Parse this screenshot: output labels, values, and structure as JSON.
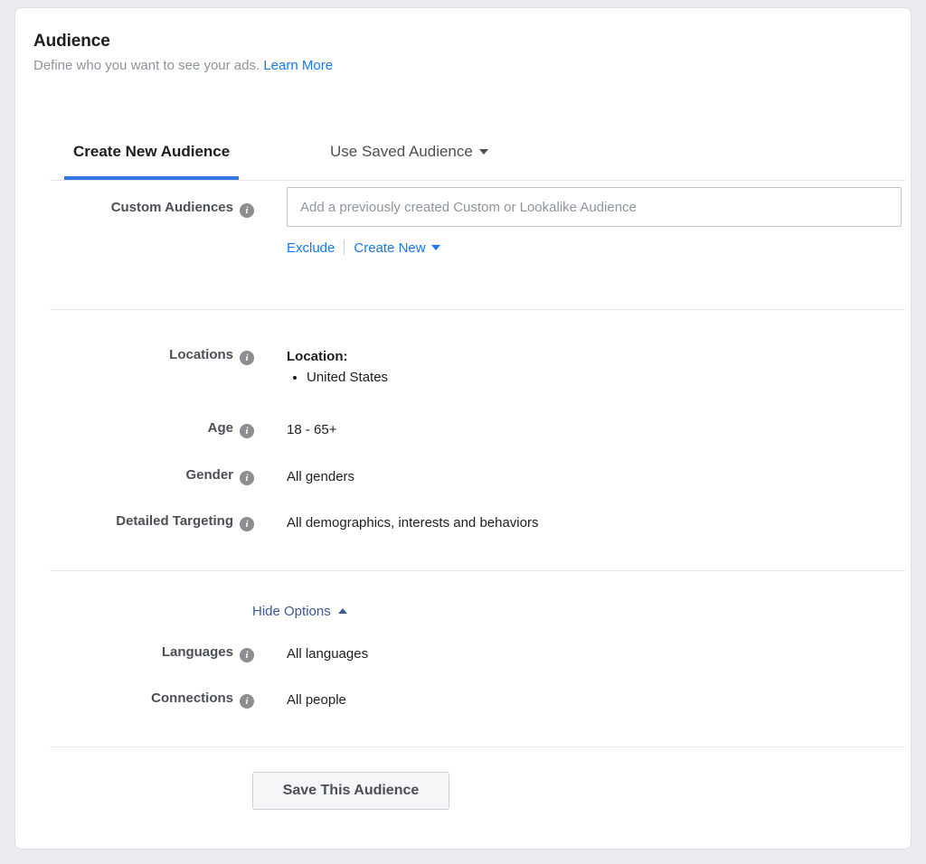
{
  "header": {
    "title": "Audience",
    "subtitle": "Define who you want to see your ads.",
    "learn_more": "Learn More"
  },
  "tabs": [
    {
      "label": "Create New Audience",
      "active": true
    },
    {
      "label": "Use Saved Audience",
      "active": false,
      "caret": "chevron-down-icon"
    }
  ],
  "custom_audiences": {
    "label": "Custom Audiences",
    "placeholder": "Add a previously created Custom or Lookalike Audience",
    "value": "",
    "exclude_label": "Exclude",
    "create_new_label": "Create New"
  },
  "locations": {
    "label": "Locations",
    "value_title": "Location:",
    "items": [
      "United States"
    ]
  },
  "age": {
    "label": "Age",
    "value": "18 - 65+"
  },
  "gender": {
    "label": "Gender",
    "value": "All genders"
  },
  "detailed_targeting": {
    "label": "Detailed Targeting",
    "value": "All demographics, interests and behaviors"
  },
  "options_toggle": {
    "label": "Hide Options"
  },
  "languages": {
    "label": "Languages",
    "value": "All languages"
  },
  "connections": {
    "label": "Connections",
    "value": "All people"
  },
  "save_button": {
    "label": "Save This Audience"
  },
  "colors": {
    "accent_blue": "#1877f2",
    "tab_underline": "#3578e5",
    "link_dark_blue": "#3b5998",
    "label_gray": "#4b4f56",
    "muted_gray": "#8d949e",
    "page_bg": "#e9ebee",
    "divider": "#e4e6eb"
  }
}
